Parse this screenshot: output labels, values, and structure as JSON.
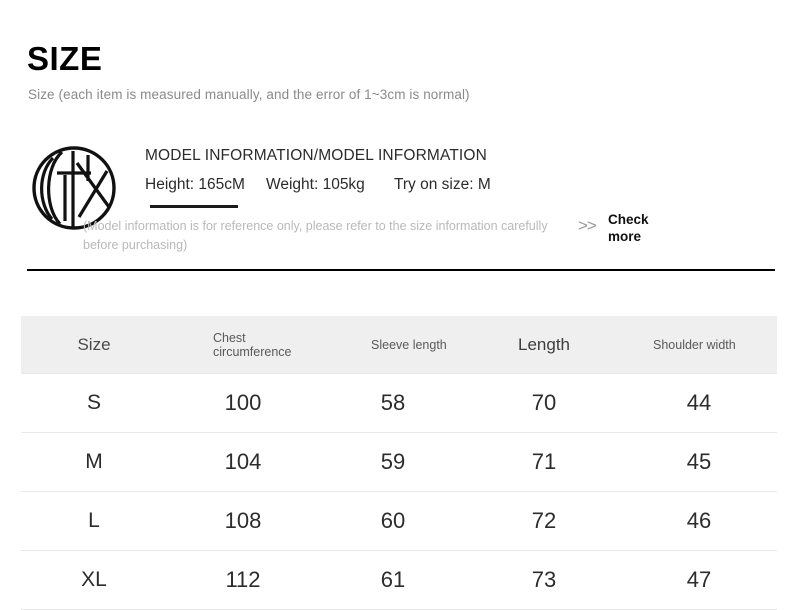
{
  "header": {
    "title": "SIZE",
    "subtitle": "Size (each item is measured manually, and the error of 1~3cm is normal)"
  },
  "model_info": {
    "logo_icon": "brand-circle-monogram-icon",
    "title": "MODEL INFORMATION/MODEL INFORMATION",
    "height": "Height: 165cM",
    "weight": "Weight: 105kg",
    "try_on_size": "Try on size: M",
    "disclaimer": "(Model information is for reference only, please refer to the size information carefully before purchasing)",
    "check_more": {
      "chevrons": ">>",
      "label": "Check more"
    }
  },
  "size_table": {
    "columns": [
      "Size",
      "Chest circumference",
      "Sleeve length",
      "Length",
      "Shoulder width"
    ],
    "rows": [
      {
        "size": "S",
        "chest": "100",
        "sleeve": "58",
        "length": "70",
        "shoulder": "44"
      },
      {
        "size": "M",
        "chest": "104",
        "sleeve": "59",
        "length": "71",
        "shoulder": "45"
      },
      {
        "size": "L",
        "chest": "108",
        "sleeve": "60",
        "length": "72",
        "shoulder": "46"
      },
      {
        "size": "XL",
        "chest": "112",
        "sleeve": "61",
        "length": "73",
        "shoulder": "47"
      }
    ]
  },
  "colors": {
    "background": "#ffffff",
    "title_text": "#000000",
    "muted_text": "#8a8a8a",
    "faint_text": "#b9b9b9",
    "divider": "#000000",
    "table_header_bg": "#efefef",
    "table_row_border": "#e8e8e8"
  }
}
